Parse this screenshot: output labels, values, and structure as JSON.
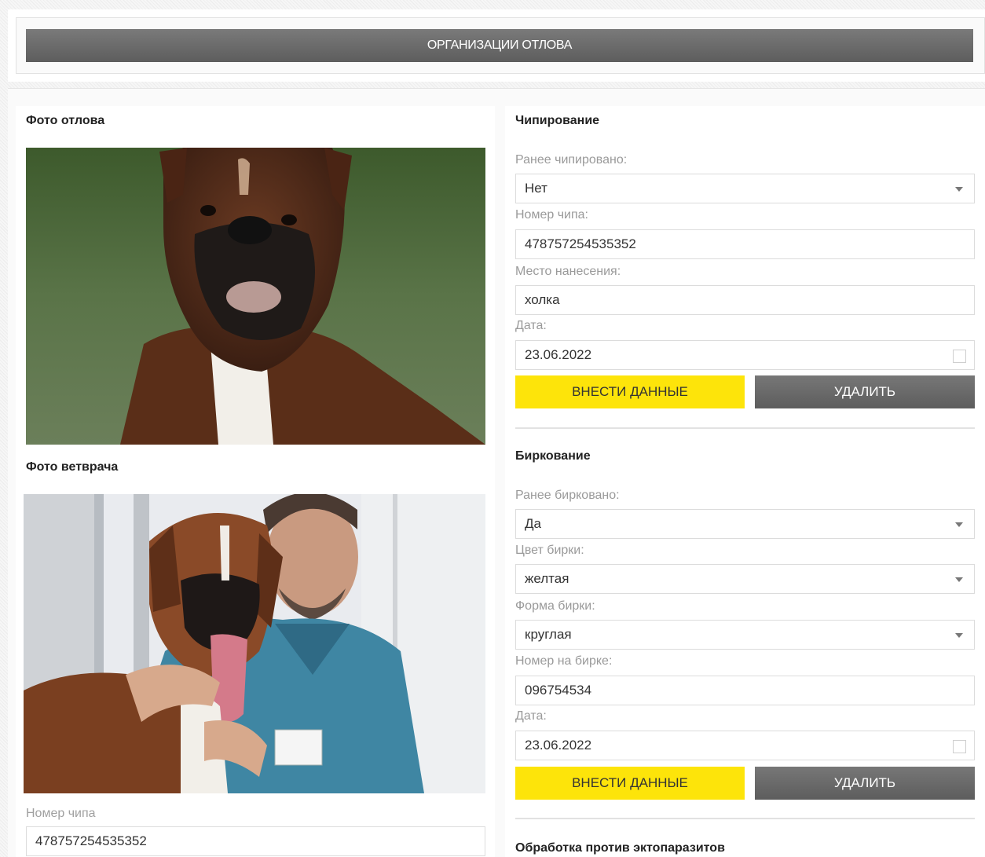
{
  "header": {
    "organization_button": "ОРГАНИЗАЦИИ ОТЛОВА"
  },
  "left": {
    "catch_photo_title": "Фото отлова",
    "vet_photo_title": "Фото ветврача",
    "chip_label": "Номер чипа",
    "chip_value": "478757254535352"
  },
  "chipping": {
    "title": "Чипирование",
    "previously_label": "Ранее чипировано:",
    "previously_value": "Нет",
    "chip_number_label": "Номер чипа:",
    "chip_number_value": "478757254535352",
    "location_label": "Место нанесения:",
    "location_value": "холка",
    "date_label": "Дата:",
    "date_value": "23.06.2022",
    "submit_label": "ВНЕСТИ ДАННЫЕ",
    "delete_label": "УДАЛИТЬ"
  },
  "tagging": {
    "title": "Биркование",
    "previously_label": "Ранее бирковано:",
    "previously_value": "Да",
    "color_label": "Цвет бирки:",
    "color_value": "желтая",
    "shape_label": "Форма бирки:",
    "shape_value": "круглая",
    "tag_number_label": "Номер на бирке:",
    "tag_number_value": "096754534",
    "date_label": "Дата:",
    "date_value": "23.06.2022",
    "submit_label": "ВНЕСТИ ДАННЫЕ",
    "delete_label": "УДАЛИТЬ"
  },
  "ectoparasite": {
    "title": "Обработка против эктопаразитов"
  },
  "colors": {
    "accent_yellow": "#fde40a",
    "button_gray": "#666666"
  }
}
